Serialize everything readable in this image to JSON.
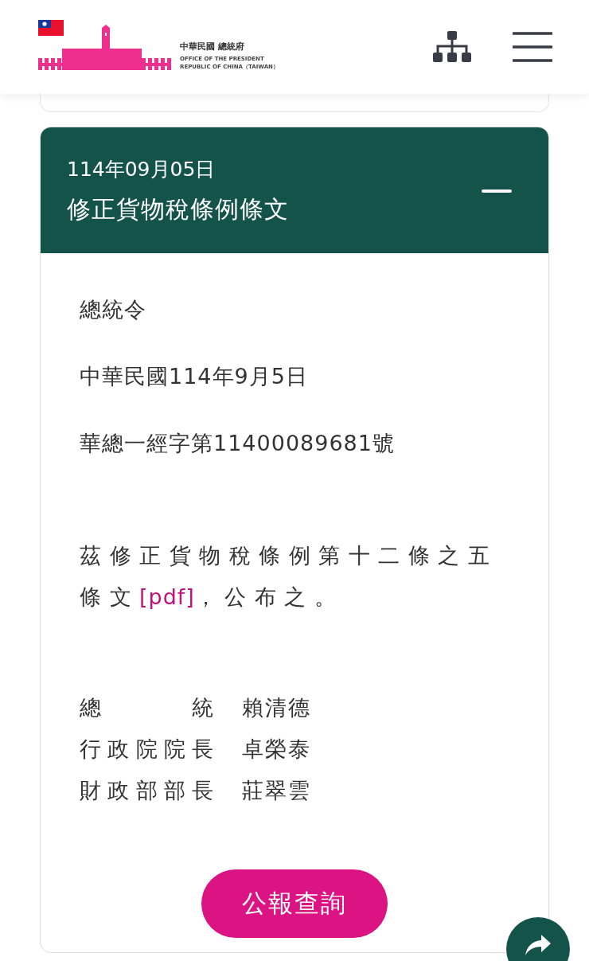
{
  "header": {
    "logo_title": "中華民國 總統府",
    "logo_subtitle_1": "OFFICE OF THE PRESIDENT",
    "logo_subtitle_2": "REPUBLIC OF CHINA（TAIWAN）"
  },
  "article": {
    "expanded": true,
    "date": "114年09月05日",
    "title": "修正貨物稅條例條文",
    "lines": [
      "總統令",
      "中華民國114年9月5日",
      "華總一經字第11400089681號"
    ],
    "paragraph": {
      "before": "茲修正貨物稅條例第十二條之五條文",
      "link": "[pdf]",
      "after": "，公布之。"
    },
    "signatures": [
      {
        "role": "總統",
        "name": "賴清德"
      },
      {
        "role": "行政院院長",
        "name": "卓榮泰"
      },
      {
        "role": "財政部部長",
        "name": "莊翠雲"
      }
    ],
    "button": "公報查詢"
  }
}
